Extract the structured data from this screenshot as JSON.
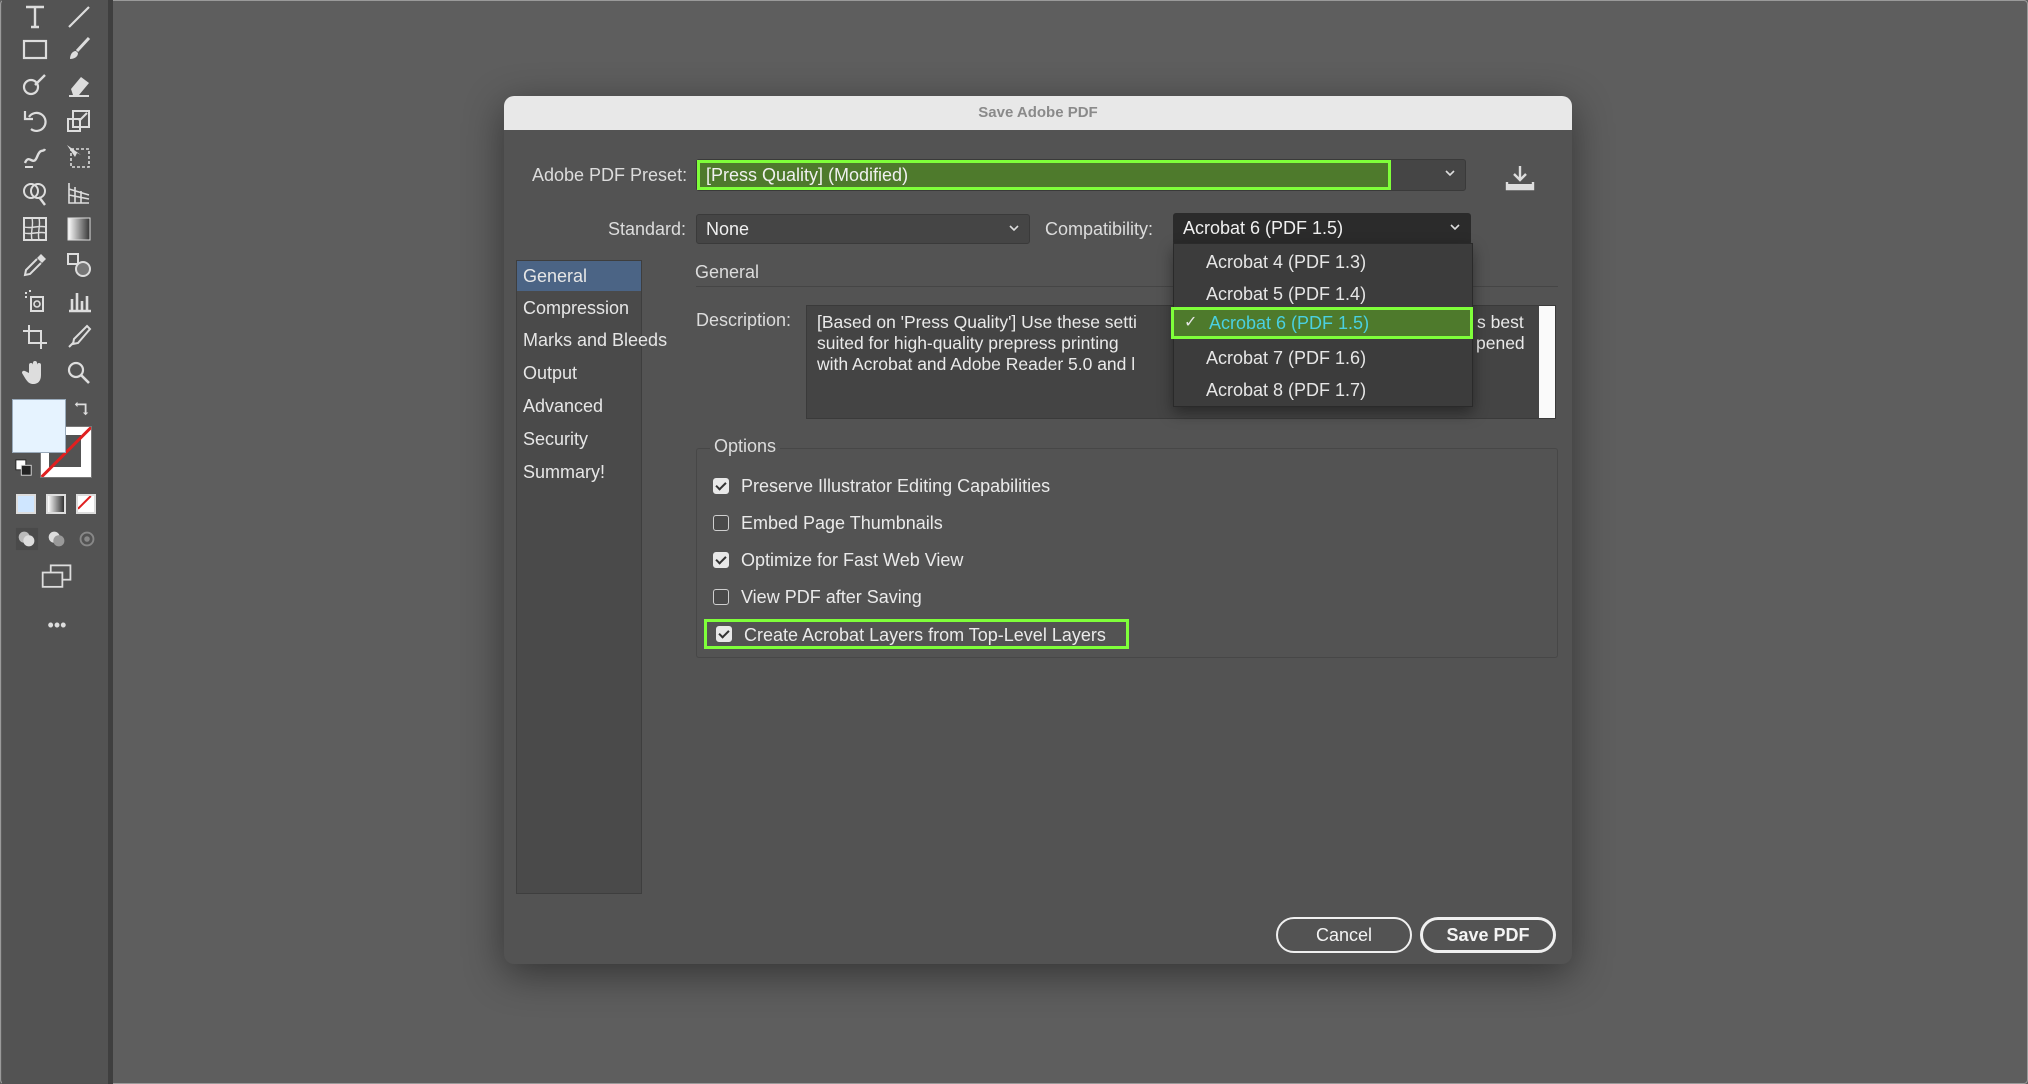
{
  "dialog": {
    "title": "Save Adobe PDF",
    "preset_label": "Adobe PDF Preset:",
    "preset_value": "[Press Quality] (Modified)",
    "standard_label": "Standard:",
    "standard_value": "None",
    "compatibility_label": "Compatibility:",
    "compatibility_value": "Acrobat 6 (PDF 1.5)",
    "compatibility_options": [
      "Acrobat 4 (PDF 1.3)",
      "Acrobat 5 (PDF 1.4)",
      "Acrobat 6 (PDF 1.5)",
      "Acrobat 7 (PDF 1.6)",
      "Acrobat 8 (PDF 1.7)"
    ],
    "selected_compatibility_index": 2,
    "sidebar": [
      "General",
      "Compression",
      "Marks and Bleeds",
      "Output",
      "Advanced",
      "Security",
      "Summary!"
    ],
    "section_title": "General",
    "description_label": "Description:",
    "description_lines": [
      "[Based on 'Press Quality'] Use these setti",
      "suited for high-quality prepress printing",
      "with Acrobat and Adobe Reader 5.0 and l"
    ],
    "description_tail": [
      "s best",
      "pened"
    ],
    "options_title": "Options",
    "options": [
      {
        "label": "Preserve Illustrator Editing Capabilities",
        "checked": true
      },
      {
        "label": "Embed Page Thumbnails",
        "checked": false
      },
      {
        "label": "Optimize for Fast Web View",
        "checked": true
      },
      {
        "label": "View PDF after Saving",
        "checked": false
      },
      {
        "label": "Create Acrobat Layers from Top-Level Layers",
        "checked": true
      }
    ],
    "cancel_label": "Cancel",
    "save_label": "Save PDF"
  },
  "toolbar": {
    "more_label": "•••"
  },
  "colors": {
    "highlight": "#7fff3a",
    "highlight_fill": "#4e7a2c",
    "sidebar_active": "#4b6485"
  }
}
